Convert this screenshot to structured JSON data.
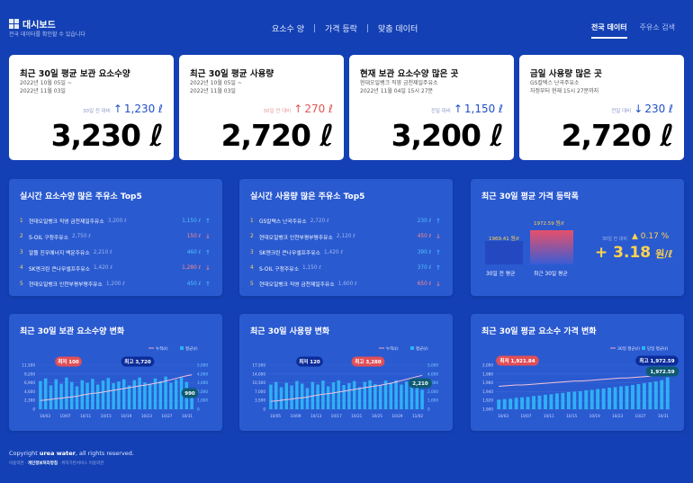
{
  "header": {
    "logo_title": "대시보드",
    "logo_sub": "전국 데이터를 확인할 수 있습니다",
    "nav": [
      "요소수 양",
      "가격 등락",
      "맞춤 데이터"
    ],
    "tabs": [
      {
        "label": "전국 데이터",
        "active": true
      },
      {
        "label": "주유소 검색",
        "active": false
      }
    ]
  },
  "stats": [
    {
      "title": "최근 30일 평균 보관 요소수양",
      "sub": "2022년 10월 05일 ~\n2022년 11월 03일",
      "change_label": "30일 전 대비",
      "change_dir": "up",
      "change": "1,230 ℓ",
      "value": "3,230 ℓ",
      "color": "blue"
    },
    {
      "title": "최근 30일 평균 사용량",
      "sub": "2022년 10월 05일 ~\n2022년 11월 03일",
      "change_label": "30일 전 대비",
      "change_dir": "up",
      "change": "270 ℓ",
      "value": "2,720 ℓ",
      "color": "red"
    },
    {
      "title": "현재 보관 요소수양 많은 곳",
      "sub": "현대오일뱅크 직영 금천제일주유소\n2022년 11월 04일 15시 27분",
      "change_label": "전일 대비",
      "change_dir": "up",
      "change": "1,150 ℓ",
      "value": "3,200 ℓ",
      "color": "blue"
    },
    {
      "title": "금일 사용량 많은 곳",
      "sub": "GS칼텍스 난곡주유소\n자정부터 현재 15시 27분까지",
      "change_label": "전일 대비",
      "change_dir": "down",
      "change": "230 ℓ",
      "value": "2,720 ℓ",
      "color": "blue"
    }
  ],
  "top_storage": {
    "title": "실시간 요소수양 많은 주유소 Top5",
    "rows": [
      {
        "rank": "1",
        "name": "현대오일뱅크 직영 금천제일주유소",
        "qty": "3,200 ℓ",
        "change": "1,150 ℓ",
        "dir": "up"
      },
      {
        "rank": "2",
        "name": "S-OIL 구청주유소",
        "qty": "2,750 ℓ",
        "change": "150 ℓ",
        "dir": "down"
      },
      {
        "rank": "3",
        "name": "알뜰 진우에너지 백운주유소",
        "qty": "2,210 ℓ",
        "change": "460 ℓ",
        "dir": "up"
      },
      {
        "rank": "4",
        "name": "SK엔크린 큰나무셀프주유소",
        "qty": "1,420 ℓ",
        "change": "1,280 ℓ",
        "dir": "down"
      },
      {
        "rank": "5",
        "name": "현대오일뱅크 인천부평부평주유소",
        "qty": "1,200 ℓ",
        "change": "450 ℓ",
        "dir": "up"
      }
    ]
  },
  "top_usage": {
    "title": "실시간 사용량 많은 주유소 Top5",
    "rows": [
      {
        "rank": "1",
        "name": "GS칼텍스 난곡주유소",
        "qty": "2,720 ℓ",
        "change": "230 ℓ",
        "dir": "up"
      },
      {
        "rank": "2",
        "name": "현대오일뱅크 인천부평부평주유소",
        "qty": "2,120 ℓ",
        "change": "450 ℓ",
        "dir": "down"
      },
      {
        "rank": "3",
        "name": "SK엔크린 큰나무셀프주유소",
        "qty": "1,420 ℓ",
        "change": "390 ℓ",
        "dir": "up"
      },
      {
        "rank": "4",
        "name": "S-OIL 구청주유소",
        "qty": "1,150 ℓ",
        "change": "370 ℓ",
        "dir": "up"
      },
      {
        "rank": "5",
        "name": "현대오일뱅크 직영 금천제일주유소",
        "qty": "1,600 ℓ",
        "change": "650 ℓ",
        "dir": "down"
      }
    ]
  },
  "price": {
    "title": "최근 30일 평균 가격 등락폭",
    "bar_prev_value": "1969.41 원/ℓ",
    "bar_curr_value": "1972.59 원/ℓ",
    "bar_prev_label": "30일 전 평균",
    "bar_curr_label": "최근 30일 평균",
    "change_label": "30일 전 대비",
    "change_pct": "▲ 0.17 %",
    "change_amount": "+ 3.18",
    "change_unit": "원/ℓ"
  },
  "charts": [
    {
      "type": "bar",
      "title": "최근 30일 보관 요소수양 변화",
      "legend": [
        "누적(ℓ)",
        "평균(ℓ)"
      ],
      "left_ticks": [
        "11,500",
        "9,200",
        "6,900",
        "4,600",
        "2,300",
        "0"
      ],
      "right_ticks": [
        "5,000",
        "4,000",
        "3,000",
        "2,000",
        "1,000",
        "0"
      ],
      "x_ticks": [
        "10/03",
        "10/07",
        "10/11",
        "10/15",
        "10/19",
        "10/23",
        "10/27",
        "10/31"
      ],
      "bars": [
        3200,
        3500,
        2700,
        3400,
        2900,
        3600,
        3100,
        2600,
        3300,
        3000,
        3450,
        2800,
        3250,
        3550,
        2950,
        3150,
        3400,
        2700,
        3300,
        3600,
        3050,
        2900,
        3500,
        3200,
        3700,
        3000,
        3350,
        3600,
        3100,
        2400
      ],
      "line": [
        1000,
        1050,
        1120,
        1200,
        1250,
        1340,
        1400,
        1480,
        1600,
        1700,
        1800,
        1850,
        1950,
        2050,
        2150,
        2250,
        2350,
        2450,
        2550,
        2650,
        2720,
        2830,
        2950,
        3050,
        3200,
        3350,
        3500,
        3650,
        3800,
        3900
      ],
      "ann_min": "최저 100",
      "ann_max": "최고 3,720",
      "ann_last": "990"
    },
    {
      "type": "bar",
      "title": "최근 30일 사용량 변화",
      "legend": [
        "누적(ℓ)",
        "평균(ℓ)"
      ],
      "left_ticks": [
        "17,500",
        "14,000",
        "10,500",
        "7,000",
        "3,500",
        "0"
      ],
      "right_ticks": [
        "5,000",
        "4,000",
        "3,000",
        "2,000",
        "1,000",
        "0"
      ],
      "x_ticks": [
        "10/05",
        "10/09",
        "10/13",
        "10/17",
        "10/21",
        "10/25",
        "10/29",
        "11/02"
      ],
      "bars": [
        2800,
        3100,
        2500,
        3000,
        2700,
        3200,
        2900,
        2400,
        3100,
        2800,
        3250,
        2600,
        3050,
        3280,
        2750,
        2950,
        3200,
        2500,
        3100,
        3280,
        2850,
        2700,
        3250,
        3000,
        3280,
        2800,
        3150,
        3280,
        2900,
        2210
      ],
      "line": [
        900,
        950,
        1020,
        1100,
        1150,
        1240,
        1300,
        1380,
        1500,
        1600,
        1700,
        1750,
        1850,
        1950,
        2050,
        2150,
        2250,
        2350,
        2450,
        2550,
        2620,
        2730,
        2850,
        2950,
        3100,
        3250,
        3400,
        3550,
        3700,
        3850
      ],
      "ann_min": "최저 120",
      "ann_max": "최고 3,280",
      "ann_last": "2,210"
    },
    {
      "type": "bar",
      "title": "최근 30일 평균 요소수 가격 변화",
      "legend": [
        "30일 평균(ℓ)",
        "당일 평균(ℓ)"
      ],
      "left_ticks": [
        "2,000",
        "1,980",
        "1,960",
        "1,940",
        "1,920",
        "1,900"
      ],
      "right_ticks": [],
      "x_ticks": [
        "10/03",
        "10/07",
        "10/11",
        "10/15",
        "10/19",
        "10/23",
        "10/27",
        "10/31"
      ],
      "bars": [
        1921.8,
        1923,
        1924,
        1926,
        1927,
        1928,
        1930,
        1931,
        1933,
        1934,
        1936,
        1937,
        1939,
        1940,
        1941,
        1943,
        1944,
        1946,
        1947,
        1949,
        1950,
        1952,
        1953,
        1955,
        1957,
        1959,
        1961,
        1963,
        1966,
        1972.6
      ],
      "line": [
        1952,
        1953,
        1954,
        1955,
        1955,
        1956,
        1957,
        1958,
        1959,
        1960,
        1961,
        1962,
        1963,
        1964,
        1964,
        1965,
        1966,
        1967,
        1968,
        1969,
        1970,
        1971,
        1971,
        1972,
        1973,
        1974,
        1975,
        1976,
        1977,
        1978
      ],
      "ann_min": "최저 1,921.84",
      "ann_max": "최고 1,972.59",
      "ann_last": "1,972.59"
    }
  ],
  "footer": {
    "copyright_pre": "Copyright ",
    "copyright_brand": "urea water",
    "copyright_post": ", all rights reserved.",
    "link1": "이용약관",
    "link2": "개인정보처리방침",
    "link3": "위치기반서비스 이용약관"
  },
  "colors": {
    "accent_blue": "#1f4fc8",
    "accent_red": "#e05454",
    "bar": "#2fb0f5",
    "line": "#ffffff"
  }
}
